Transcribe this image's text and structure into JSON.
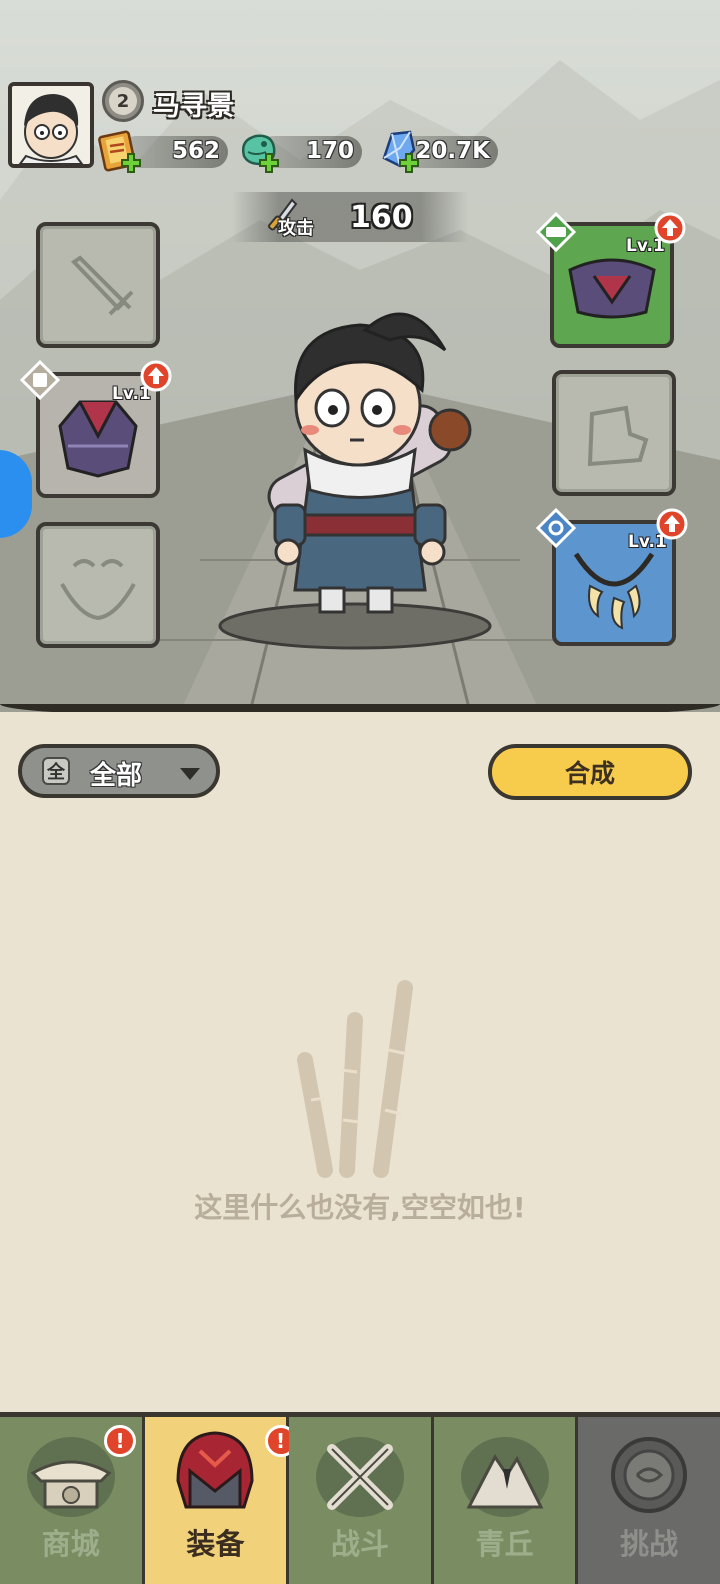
{
  "player": {
    "name": "马寻景",
    "level": "2"
  },
  "resources": [
    {
      "name": "scroll-currency-icon",
      "value": "562"
    },
    {
      "name": "jade-currency-icon",
      "value": "170"
    },
    {
      "name": "crystal-currency-icon",
      "value": "20.7K"
    }
  ],
  "stats": {
    "attack_label": "攻击",
    "attack_value": "160"
  },
  "slots": {
    "weapon": {
      "state": "empty"
    },
    "armor": {
      "level": "Lv.1"
    },
    "accessory": {
      "state": "empty"
    },
    "belt": {
      "level": "Lv.1"
    },
    "boots": {
      "state": "empty"
    },
    "necklace": {
      "level": "Lv.1"
    }
  },
  "inventory": {
    "filter_chip": "全",
    "filter_label": "全部",
    "compose_label": "合成",
    "empty_text": "这里什么也没有,空空如也!"
  },
  "nav": {
    "items": [
      {
        "label": "商城",
        "alert": "!"
      },
      {
        "label": "装备",
        "alert": "!"
      },
      {
        "label": "战斗"
      },
      {
        "label": "青丘"
      },
      {
        "label": "挑战"
      }
    ]
  },
  "colors": {
    "compose_button": "#f7cc4c",
    "active_tab": "#f1d27a",
    "alert": "#e0442a"
  }
}
